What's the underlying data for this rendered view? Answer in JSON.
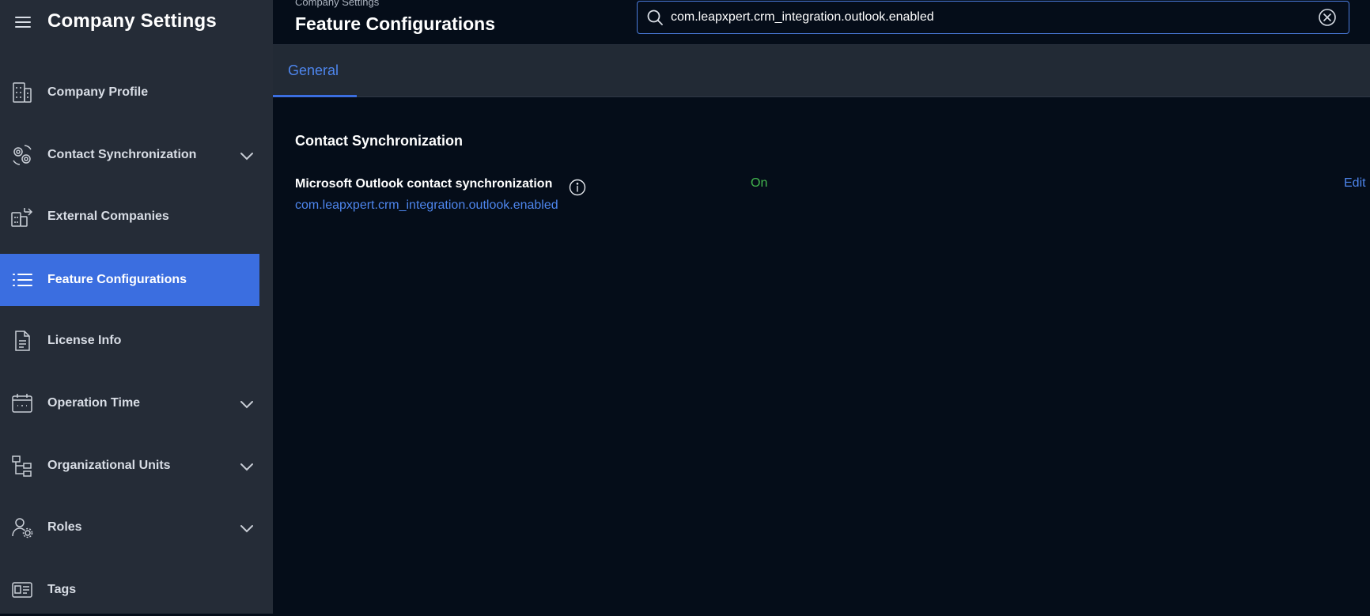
{
  "sidebar": {
    "title": "Company Settings",
    "items": [
      {
        "label": "Company Profile",
        "icon": "building-icon",
        "expandable": false,
        "active": false
      },
      {
        "label": "Contact Synchronization",
        "icon": "sync-gears-icon",
        "expandable": true,
        "active": false
      },
      {
        "label": "External Companies",
        "icon": "external-buildings-icon",
        "expandable": false,
        "active": false
      },
      {
        "label": "Feature Configurations",
        "icon": "list-icon",
        "expandable": false,
        "active": true
      },
      {
        "label": "License Info",
        "icon": "document-icon",
        "expandable": false,
        "active": false
      },
      {
        "label": "Operation Time",
        "icon": "calendar-icon",
        "expandable": true,
        "active": false
      },
      {
        "label": "Organizational Units",
        "icon": "org-tree-icon",
        "expandable": true,
        "active": false
      },
      {
        "label": "Roles",
        "icon": "user-gear-icon",
        "expandable": true,
        "active": false
      },
      {
        "label": "Tags",
        "icon": "tag-card-icon",
        "expandable": false,
        "active": false
      }
    ]
  },
  "header": {
    "breadcrumb": "Company Settings",
    "title": "Feature Configurations"
  },
  "search": {
    "value": "com.leapxpert.crm_integration.outlook.enabled",
    "placeholder": ""
  },
  "tabs": [
    {
      "label": "General",
      "active": true
    }
  ],
  "main": {
    "section_title": "Contact Synchronization",
    "settings": [
      {
        "name": "Microsoft Outlook contact synchronization",
        "key": "com.leapxpert.crm_integration.outlook.enabled",
        "value": "On",
        "action": "Edit"
      }
    ]
  },
  "colors": {
    "accent": "#3b6ee0",
    "link": "#4e86ee",
    "status_on": "#43b74e",
    "sidebar_bg": "#252c37",
    "page_bg": "#050d19"
  }
}
